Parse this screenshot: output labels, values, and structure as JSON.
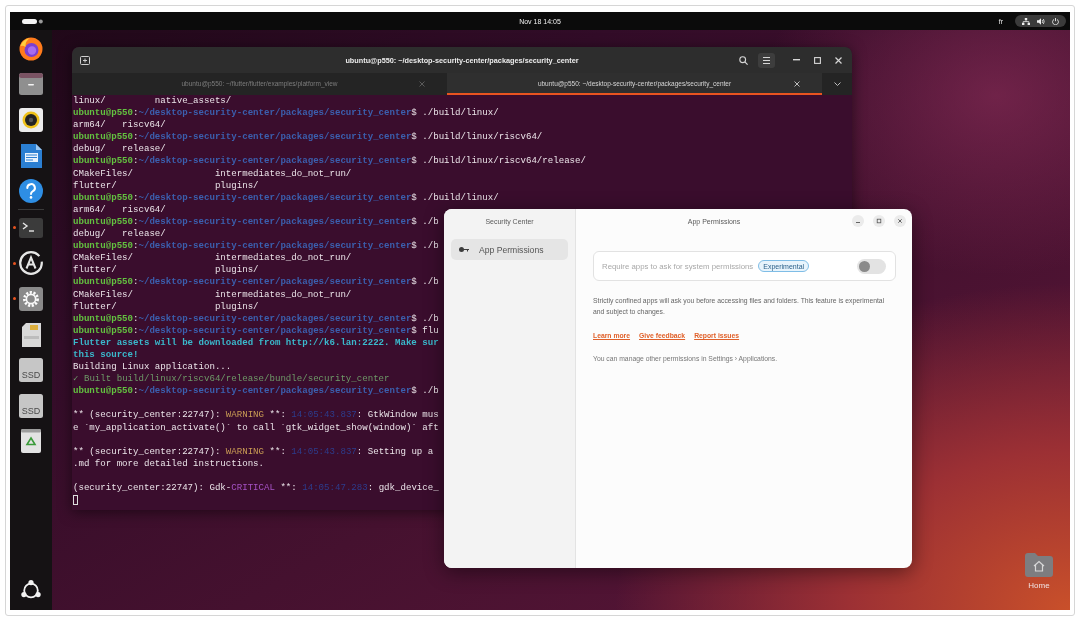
{
  "top_bar": {
    "clock": "Nov 18 14:05",
    "keyboard_layout": "fr"
  },
  "dock": {
    "favorites": [
      {
        "kind": "browser",
        "running": false
      },
      {
        "kind": "files",
        "running": false
      },
      {
        "kind": "music",
        "running": false
      },
      {
        "kind": "writer",
        "running": false
      },
      {
        "kind": "help",
        "running": false
      }
    ],
    "others": [
      {
        "kind": "terminal",
        "running": true
      },
      {
        "kind": "software",
        "running": true
      },
      {
        "kind": "settings",
        "running": true
      },
      {
        "kind": "sd-card",
        "running": false
      },
      {
        "kind": "drive",
        "label": "SSD",
        "running": false
      },
      {
        "kind": "drive",
        "label": "SSD",
        "running": false
      },
      {
        "kind": "trash",
        "running": false
      }
    ]
  },
  "terminal": {
    "title": "ubuntu@p550: ~/desktop-security-center/packages/security_center",
    "tabs": [
      {
        "label": "ubuntu@p550: ~/flutter/flutter/examples/platform_view",
        "selected": false
      },
      {
        "label": "ubuntu@p550: ~/desktop-security-center/packages/security_center",
        "selected": true
      }
    ],
    "lines": [
      {
        "kind": "text",
        "segments": [
          {
            "kind": "plain",
            "text": "linux/         native_assets/"
          }
        ]
      },
      {
        "kind": "text",
        "segments": [
          {
            "kind": "user",
            "text": "ubuntu@p550"
          },
          {
            "kind": "plain",
            "text": ":"
          },
          {
            "kind": "path",
            "text": "~/desktop-security-center/packages/security_center"
          },
          {
            "kind": "plain",
            "text": "$ ./build/linux/"
          }
        ]
      },
      {
        "kind": "text",
        "segments": [
          {
            "kind": "plain",
            "text": "arm64/   riscv64/"
          }
        ]
      },
      {
        "kind": "text",
        "segments": [
          {
            "kind": "user",
            "text": "ubuntu@p550"
          },
          {
            "kind": "plain",
            "text": ":"
          },
          {
            "kind": "path",
            "text": "~/desktop-security-center/packages/security_center"
          },
          {
            "kind": "plain",
            "text": "$ ./build/linux/riscv64/"
          }
        ]
      },
      {
        "kind": "text",
        "segments": [
          {
            "kind": "plain",
            "text": "debug/   release/"
          }
        ]
      },
      {
        "kind": "text",
        "segments": [
          {
            "kind": "user",
            "text": "ubuntu@p550"
          },
          {
            "kind": "plain",
            "text": ":"
          },
          {
            "kind": "path",
            "text": "~/desktop-security-center/packages/security_center"
          },
          {
            "kind": "plain",
            "text": "$ ./build/linux/riscv64/release/"
          }
        ]
      },
      {
        "kind": "text",
        "segments": [
          {
            "kind": "plain",
            "text": "CMakeFiles/               intermediates_do_not_run/"
          }
        ]
      },
      {
        "kind": "text",
        "segments": [
          {
            "kind": "plain",
            "text": "flutter/                  plugins/"
          }
        ]
      },
      {
        "kind": "text",
        "segments": [
          {
            "kind": "user",
            "text": "ubuntu@p550"
          },
          {
            "kind": "plain",
            "text": ":"
          },
          {
            "kind": "path",
            "text": "~/desktop-security-center/packages/security_center"
          },
          {
            "kind": "plain",
            "text": "$ ./build/linux/"
          }
        ]
      },
      {
        "kind": "text",
        "segments": [
          {
            "kind": "plain",
            "text": "arm64/   riscv64/"
          }
        ]
      },
      {
        "kind": "text",
        "segments": [
          {
            "kind": "user",
            "text": "ubuntu@p550"
          },
          {
            "kind": "plain",
            "text": ":"
          },
          {
            "kind": "path",
            "text": "~/desktop-security-center/packages/security_center"
          },
          {
            "kind": "plain",
            "text": "$ ./b"
          }
        ]
      },
      {
        "kind": "text",
        "segments": [
          {
            "kind": "plain",
            "text": "debug/   release/"
          }
        ]
      },
      {
        "kind": "text",
        "segments": [
          {
            "kind": "user",
            "text": "ubuntu@p550"
          },
          {
            "kind": "plain",
            "text": ":"
          },
          {
            "kind": "path",
            "text": "~/desktop-security-center/packages/security_center"
          },
          {
            "kind": "plain",
            "text": "$ ./b"
          }
        ]
      },
      {
        "kind": "text",
        "segments": [
          {
            "kind": "plain",
            "text": "CMakeFiles/               intermediates_do_not_run/"
          }
        ]
      },
      {
        "kind": "text",
        "segments": [
          {
            "kind": "plain",
            "text": "flutter/                  plugins/"
          }
        ]
      },
      {
        "kind": "text",
        "segments": [
          {
            "kind": "user",
            "text": "ubuntu@p550"
          },
          {
            "kind": "plain",
            "text": ":"
          },
          {
            "kind": "path",
            "text": "~/desktop-security-center/packages/security_center"
          },
          {
            "kind": "plain",
            "text": "$ ./b"
          }
        ]
      },
      {
        "kind": "text",
        "segments": [
          {
            "kind": "plain",
            "text": "CMakeFiles/               intermediates_do_not_run/"
          }
        ]
      },
      {
        "kind": "text",
        "segments": [
          {
            "kind": "plain",
            "text": "flutter/                  plugins/"
          }
        ]
      },
      {
        "kind": "text",
        "segments": [
          {
            "kind": "user",
            "text": "ubuntu@p550"
          },
          {
            "kind": "plain",
            "text": ":"
          },
          {
            "kind": "path",
            "text": "~/desktop-security-center/packages/security_center"
          },
          {
            "kind": "plain",
            "text": "$ ./b"
          }
        ]
      },
      {
        "kind": "text",
        "segments": [
          {
            "kind": "user",
            "text": "ubuntu@p550"
          },
          {
            "kind": "plain",
            "text": ":"
          },
          {
            "kind": "path",
            "text": "~/desktop-security-center/packages/security_center"
          },
          {
            "kind": "plain",
            "text": "$ flu"
          }
        ]
      },
      {
        "kind": "text",
        "segments": [
          {
            "kind": "info",
            "text": "Flutter assets will be downloaded from http://k6.lan:2222. Make sur"
          }
        ]
      },
      {
        "kind": "text",
        "segments": [
          {
            "kind": "info",
            "text": "this source!"
          }
        ]
      },
      {
        "kind": "text",
        "segments": [
          {
            "kind": "plain",
            "text": "Building Linux application..."
          }
        ]
      },
      {
        "kind": "text",
        "segments": [
          {
            "kind": "success",
            "text": "✓ Built build/linux/riscv64/release/bundle/security_center"
          }
        ]
      },
      {
        "kind": "text",
        "segments": [
          {
            "kind": "user",
            "text": "ubuntu@p550"
          },
          {
            "kind": "plain",
            "text": ":"
          },
          {
            "kind": "path",
            "text": "~/desktop-security-center/packages/security_center"
          },
          {
            "kind": "plain",
            "text": "$ ./b"
          }
        ]
      },
      {
        "kind": "blank"
      },
      {
        "kind": "text",
        "segments": [
          {
            "kind": "plain",
            "text": "** (security_center:22747): "
          },
          {
            "kind": "warning",
            "text": "WARNING"
          },
          {
            "kind": "plain",
            "text": " **: "
          },
          {
            "kind": "timestamp",
            "text": "14:05:43.837"
          },
          {
            "kind": "plain",
            "text": ": GtkWindow mus"
          }
        ]
      },
      {
        "kind": "text",
        "segments": [
          {
            "kind": "plain",
            "text": "e `my_application_activate()` to call `gtk_widget_show(window)` aft"
          }
        ]
      },
      {
        "kind": "blank"
      },
      {
        "kind": "text",
        "segments": [
          {
            "kind": "plain",
            "text": "** (security_center:22747): "
          },
          {
            "kind": "warning",
            "text": "WARNING"
          },
          {
            "kind": "plain",
            "text": " **: "
          },
          {
            "kind": "timestamp",
            "text": "14:05:43.837"
          },
          {
            "kind": "plain",
            "text": ": Setting up a"
          }
        ]
      },
      {
        "kind": "text",
        "segments": [
          {
            "kind": "plain",
            "text": ".md for more detailed instructions."
          }
        ]
      },
      {
        "kind": "blank"
      },
      {
        "kind": "text",
        "segments": [
          {
            "kind": "plain",
            "text": "(security_center:22747): Gdk-"
          },
          {
            "kind": "critical",
            "text": "CRITICAL"
          },
          {
            "kind": "plain",
            "text": " **: "
          },
          {
            "kind": "timestamp",
            "text": "14:05:47.283"
          },
          {
            "kind": "plain",
            "text": ": gdk_device_"
          }
        ]
      },
      {
        "kind": "cursor"
      }
    ]
  },
  "security_center": {
    "sidebar_title": "Security Center",
    "sidebar_items": [
      {
        "label": "App Permissions",
        "selected": true
      }
    ],
    "page_title": "App Permissions",
    "setting": {
      "label": "Require apps to ask for system permissions",
      "badge": "Experimental",
      "on": false,
      "disabled": true
    },
    "description": "Strictly confined apps will ask you before accessing files and folders. This feature is experimental and subject to changes.",
    "links": [
      "Learn more",
      "Give feedback",
      "Report issues"
    ],
    "note": "You can manage other permissions in Settings › Applications."
  },
  "desktop_icons": [
    {
      "label": "Home"
    }
  ]
}
